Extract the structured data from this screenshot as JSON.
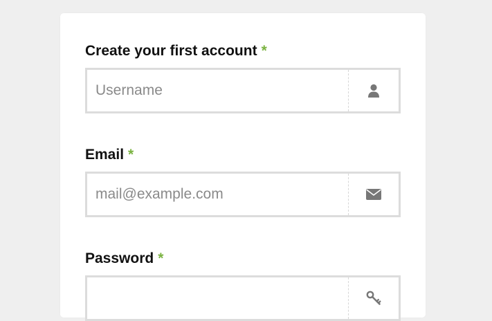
{
  "form": {
    "username": {
      "label": "Create your first account",
      "required_mark": "*",
      "placeholder": "Username",
      "icon": "user-icon"
    },
    "email": {
      "label": "Email",
      "required_mark": "*",
      "placeholder": "mail@example.com",
      "icon": "envelope-icon"
    },
    "password": {
      "label": "Password",
      "required_mark": "*",
      "placeholder": "",
      "icon": "key-icon"
    }
  },
  "colors": {
    "background": "#efefef",
    "card": "#ffffff",
    "required_accent": "#7bb342",
    "input_border": "#dcdcdc",
    "icon": "#777777",
    "placeholder": "#8a8a8a"
  }
}
